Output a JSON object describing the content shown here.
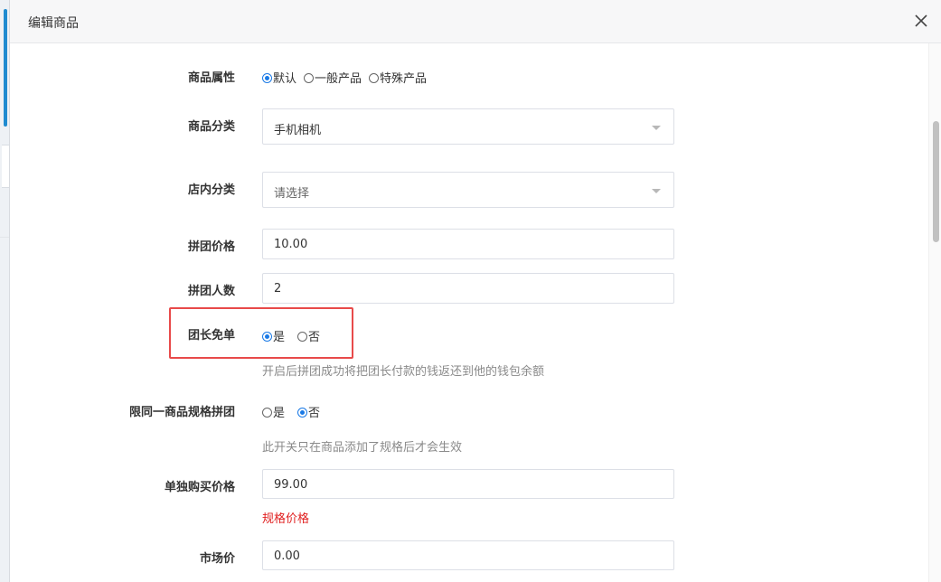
{
  "modal": {
    "title": "编辑商品",
    "close_icon": "close-icon"
  },
  "colors": {
    "accent": "#1a7ae6",
    "highlight": "#e84a4a",
    "error_text": "#e02020",
    "help_text": "#8a8a8a"
  },
  "form": {
    "attribute": {
      "label": "商品属性",
      "options": [
        "默认",
        "一般产品",
        "特殊产品"
      ],
      "selected": "默认"
    },
    "category": {
      "label": "商品分类",
      "value": "手机相机"
    },
    "shop_category": {
      "label": "店内分类",
      "placeholder": "请选择"
    },
    "group_price": {
      "label": "拼团价格",
      "value": "10.00"
    },
    "group_size": {
      "label": "拼团人数",
      "value": "2"
    },
    "leader_free": {
      "label": "团长免单",
      "options": [
        "是",
        "否"
      ],
      "selected": "是",
      "help": "开启后拼团成功将把团长付款的钱返还到他的钱包余额"
    },
    "limit_spec": {
      "label": "限同一商品规格拼团",
      "options": [
        "是",
        "否"
      ],
      "selected": "否",
      "help": "此开关只在商品添加了规格后才会生效"
    },
    "single_price": {
      "label": "单独购买价格",
      "value": "99.00",
      "note": "规格价格"
    },
    "market_price": {
      "label": "市场价",
      "value": "0.00"
    }
  }
}
